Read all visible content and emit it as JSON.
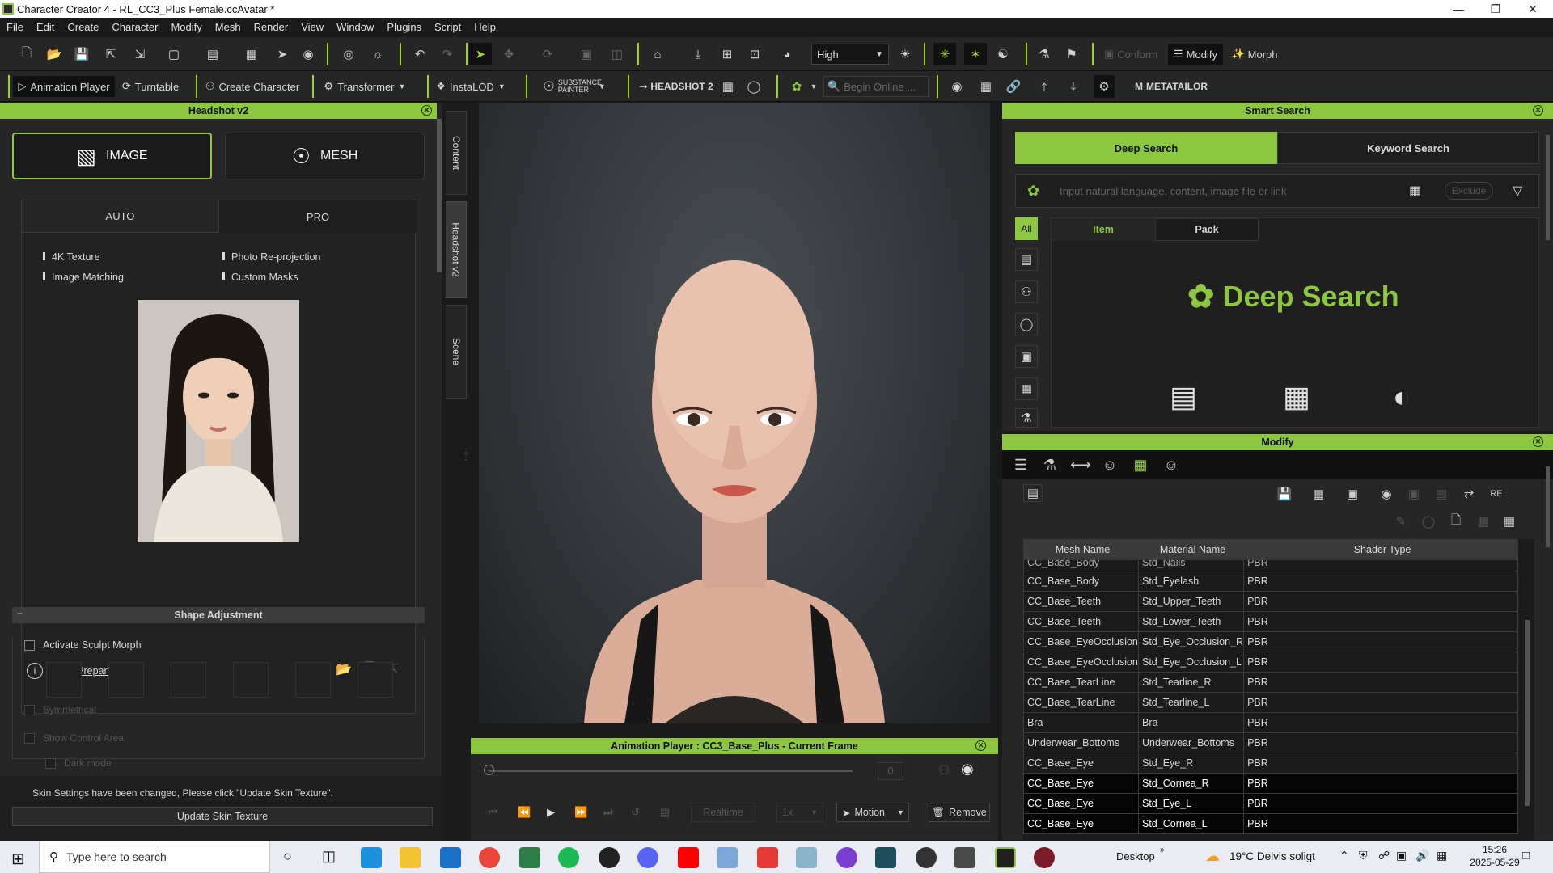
{
  "window": {
    "title": "Character Creator 4 - RL_CC3_Plus Female.ccAvatar *"
  },
  "menu": [
    "File",
    "Edit",
    "Create",
    "Character",
    "Modify",
    "Mesh",
    "Render",
    "View",
    "Window",
    "Plugins",
    "Script",
    "Help"
  ],
  "toolbar1": {
    "quality": "High",
    "conform": "Conform",
    "modify": "Modify",
    "morph": "Morph"
  },
  "toolbar2": {
    "animation_player": "Animation Player",
    "turntable": "Turntable",
    "create_character": "Create Character",
    "transformer": "Transformer",
    "instalod": "InstaLOD",
    "substance": "SUBSTANCE PAINTER",
    "headshot": "HEADSHOT 2",
    "search_placeholder": "Begin Online ...",
    "metatailor": "METATAILOR"
  },
  "headshot": {
    "title": "Headshot v2",
    "image_btn": "IMAGE",
    "mesh_btn": "MESH",
    "tab_auto": "AUTO",
    "tab_pro": "PRO",
    "features": [
      "4K Texture",
      "Photo Re-projection",
      "Image Matching",
      "Custom Masks"
    ],
    "photo_prep": "Photo Preparation",
    "shape_adjustment": "Shape Adjustment",
    "activate_sculpt": "Activate Sculpt Morph",
    "symmetrical": "Symmetrical",
    "show_control_area": "Show Control Area",
    "dark_mode": "Dark mode",
    "skin_notice": "Skin Settings have been changed, Please click \"Update Skin Texture\".",
    "update_btn": "Update Skin Texture"
  },
  "side_tabs": [
    "Content",
    "Headshot v2",
    "Scene"
  ],
  "anim_player": {
    "title": "Animation Player : CC3_Base_Plus - Current Frame",
    "frame": "0",
    "realtime": "Realtime",
    "speed": "1x",
    "motion": "Motion",
    "remove": "Remove"
  },
  "smart_search": {
    "title": "Smart Search",
    "tab_deep": "Deep Search",
    "tab_keyword": "Keyword Search",
    "placeholder": "Input natural language, content, image file or link",
    "exclude": "Exclude",
    "all": "All",
    "item": "Item",
    "pack": "Pack",
    "brand": "Deep Search"
  },
  "modify": {
    "title": "Modify",
    "columns": [
      "Mesh Name",
      "Material Name",
      "Shader Type"
    ],
    "rows": [
      [
        "CC_Base_Body",
        "Std_Nails",
        "PBR"
      ],
      [
        "CC_Base_Body",
        "Std_Eyelash",
        "PBR"
      ],
      [
        "CC_Base_Teeth",
        "Std_Upper_Teeth",
        "PBR"
      ],
      [
        "CC_Base_Teeth",
        "Std_Lower_Teeth",
        "PBR"
      ],
      [
        "CC_Base_EyeOcclusion",
        "Std_Eye_Occlusion_R",
        "PBR"
      ],
      [
        "CC_Base_EyeOcclusion",
        "Std_Eye_Occlusion_L",
        "PBR"
      ],
      [
        "CC_Base_TearLine",
        "Std_Tearline_R",
        "PBR"
      ],
      [
        "CC_Base_TearLine",
        "Std_Tearline_L",
        "PBR"
      ],
      [
        "Bra",
        "Bra",
        "PBR"
      ],
      [
        "Underwear_Bottoms",
        "Underwear_Bottoms",
        "PBR"
      ],
      [
        "CC_Base_Eye",
        "Std_Eye_R",
        "PBR"
      ],
      [
        "CC_Base_Eye",
        "Std_Cornea_R",
        "PBR"
      ],
      [
        "CC_Base_Eye",
        "Std_Eye_L",
        "PBR"
      ],
      [
        "CC_Base_Eye",
        "Std_Cornea_L",
        "PBR"
      ]
    ],
    "selected_rows": [
      11,
      12,
      13
    ],
    "shader_btn": "RE"
  },
  "taskbar": {
    "search": "Type here to search",
    "desktop": "Desktop",
    "weather": "19°C  Delvis soligt",
    "time": "15:26",
    "date": "2025-05-29"
  },
  "colors": {
    "accent": "#8dc63f",
    "panel": "#262626",
    "viewport": "#3a3e42"
  }
}
